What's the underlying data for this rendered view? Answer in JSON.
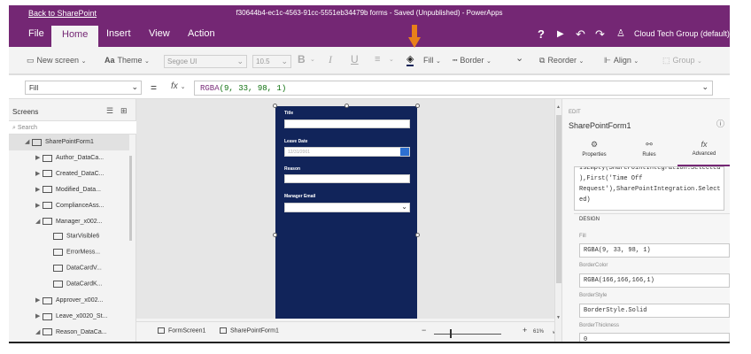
{
  "titlebar": {
    "back": "Back to SharePoint",
    "title": "f30644b4-ec1c-4563-91cc-5551eb34479b forms - Saved (Unpublished) - PowerApps"
  },
  "menubar": {
    "items": [
      "File",
      "Home",
      "Insert",
      "View",
      "Action"
    ],
    "active": "Home",
    "org": "Cloud Tech Group (default)"
  },
  "ribbon": {
    "new_screen": "New screen",
    "theme": "Theme",
    "font": "Segoe UI",
    "size": "10.5",
    "fill": "Fill",
    "border": "Border",
    "reorder": "Reorder",
    "align": "Align",
    "group": "Group"
  },
  "formula": {
    "property": "Fill",
    "fx": "fx",
    "fn": "RGBA",
    "args": "(9, 33, 98, 1)"
  },
  "screens": {
    "header": "Screens",
    "search_placeholder": "Search",
    "items": [
      {
        "label": "SharePointForm1",
        "level": 0,
        "expander": "◢",
        "selected": true
      },
      {
        "label": "Author_DataCa...",
        "level": 1,
        "expander": "▶"
      },
      {
        "label": "Created_DataC...",
        "level": 1,
        "expander": "▶"
      },
      {
        "label": "Modified_Data...",
        "level": 1,
        "expander": "▶"
      },
      {
        "label": "ComplianceAss...",
        "level": 1,
        "expander": "▶"
      },
      {
        "label": "Manager_x002...",
        "level": 1,
        "expander": "◢"
      },
      {
        "label": "StarVisible6",
        "level": 2,
        "expander": ""
      },
      {
        "label": "ErrorMess...",
        "level": 2,
        "expander": ""
      },
      {
        "label": "DataCardV...",
        "level": 2,
        "expander": ""
      },
      {
        "label": "DataCardK...",
        "level": 2,
        "expander": ""
      },
      {
        "label": "Approver_x002...",
        "level": 1,
        "expander": "▶"
      },
      {
        "label": "Leave_x0020_St...",
        "level": 1,
        "expander": "▶"
      },
      {
        "label": "Reason_DataCa...",
        "level": 1,
        "expander": "◢"
      }
    ]
  },
  "form": {
    "fields": {
      "title_label": "Title",
      "leave_date_label": "Leave Date",
      "leave_date_value": "12/31/2001",
      "reason_label": "Reason",
      "manager_email_label": "Manager Email"
    },
    "background": "#092162"
  },
  "bottombar": {
    "tab1": "FormScreen1",
    "tab2": "SharePointForm1",
    "zoom_minus": "−",
    "zoom_plus": "+",
    "zoom_value": "61%"
  },
  "rightpane": {
    "edit": "EDIT",
    "name": "SharePointForm1",
    "tabs": [
      "Properties",
      "Rules",
      "Advanced"
    ],
    "active_tab": "Advanced",
    "code_lines": [
      "IsEmpty(SharePointIntegration.Selected",
      "),First('Time Off",
      "Request'),SharePointIntegration.Select",
      "ed)"
    ],
    "design": "DESIGN",
    "props": [
      {
        "label": "Fill",
        "value": "RGBA(9, 33, 98, 1)"
      },
      {
        "label": "BorderColor",
        "value": "RGBA(166,166,166,1)"
      },
      {
        "label": "BorderStyle",
        "value": "BorderStyle.Solid"
      },
      {
        "label": "BorderThickness",
        "value": "0"
      }
    ]
  },
  "colors": {
    "accent": "#742774",
    "form_fill": "#11245a",
    "hint_arrow": "#e8801a"
  }
}
